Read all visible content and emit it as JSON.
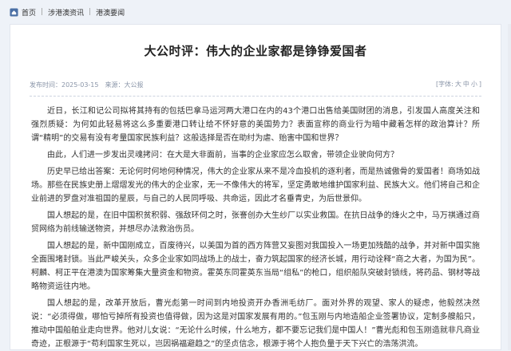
{
  "breadcrumb": {
    "home": "首页",
    "level1": "涉港澳资讯",
    "level2": "港澳要闻"
  },
  "article": {
    "title": "大公时评：伟大的企业家都是铮铮爱国者",
    "date_label": "发布时间：2025-03-15",
    "source_label": "来源：大公报",
    "font_size_label": "[字体:",
    "font_large": "大",
    "font_medium": "中",
    "font_small": "小",
    "font_close": "]",
    "paragraphs": [
      "近日，长江和记公司拟将其持有的包括巴拿马运河两大港口在内的43个港口出售给美国财团的消息，引发国人高度关注和强烈质疑：为何如此轻易将这么多重要港口转让给不怀好意的美国势力？表面宣称的商业行为暗中藏着怎样的政治算计？所谓“精明”的交易有没有考量国家民族利益？这般选择是否在助纣为虐、贻害中国和世界？",
      "由此，人们进一步发出灵魂拷问：在大是大非面前，当事的企业家应怎么取舍，带领企业驶向何方？",
      "历史早已给出答案：无论何时何地何种情况，伟大的企业家从来不是冷血投机的逐利者，而是热诚傲骨的爱国者！商场如战场。那些在民族史册上熠熠发光的伟大的企业家，无一不像伟大的将军，坚定勇敢地维护国家利益、民族大义。他们将自己和企业前进的罗盘对准祖国的星辰，与自己的人民同呼吸、共命运，因此才名垂青史，为后世景仰。",
      "国人想起的是，在旧中国积贫积弱、强敌环伺之时，张謇创办大生纱厂以实业救国。在抗日战争的烽火之中，马万祺通过商贸网络为前线输送物资，并想尽办法救治伤员。",
      "国人想起的是，新中国刚成立，百废待兴，以美国为首的西方阵营又妄图对我国投入一场更加残酷的战争，并对新中国实施全面围堵封锁。当此严峻关头，众多企业家如同战场上的战士，奋力筑起国家的经济长城，用行动诠释“商之大者，为国为民”。柯麟、柯正平在港澳为国家筹集大量资金和物资。霍英东同霍英东当局“组私”的枪口，组织船队突破封锁线，将药品、钢材等战略物资运往内地。",
      "国人想起的是，改革开放后，曹光彪第一时间到内地投资开办香洲毛纺厂。面对外界的观望、家人的疑虑，他毅然决然说：“必须得做，哪怕亏掉所有投资也值得做，因为这是对国家发展有用的。”包玉刚与内地造船企业签署协议，定制多艘船只，推动中国船舶业走向世界。他对儿女说：“无论什么时候，什么地方，都不要忘记我们是中国人！”曹光彪和包玉刚造就非凡商业奇迹，正根源于“苟利国家生死以，岂因祸福避趋之”的坚贞信念，根源于将个人抱负量于天下兴亡的浩荡洪流。"
    ]
  },
  "colors": {
    "page_background": "#eef2f8",
    "card_background": "#ffffff",
    "meta_text": "#8a95a8"
  }
}
